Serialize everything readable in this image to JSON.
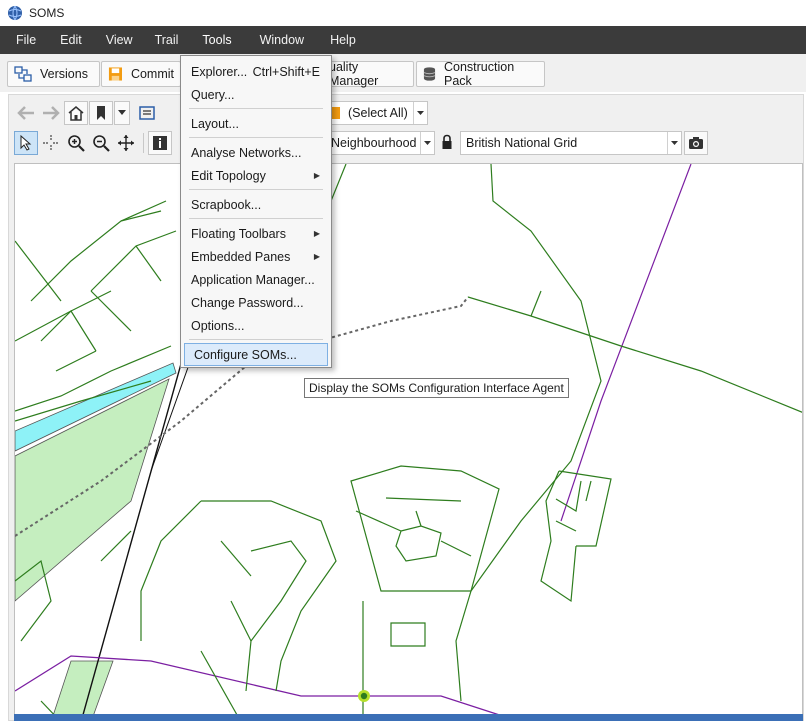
{
  "window": {
    "title": "SOMS",
    "app_icon": "globe-icon"
  },
  "menubar": {
    "items": [
      "File",
      "Edit",
      "View",
      "Trail",
      "Tools",
      "Window",
      "Help"
    ],
    "active": "Tools"
  },
  "toolbar": {
    "versions_label": "Versions",
    "commit_label": "Commit",
    "quality_manager_label": "uality Manager",
    "construction_pack_label": "Construction Pack"
  },
  "map_toolbar": {
    "layer_select_label": "(Select All)",
    "scale_label": "Neighbourhood",
    "projection_label": "British National Grid"
  },
  "tools_menu": {
    "items": [
      {
        "label": "Explorer...",
        "shortcut": "Ctrl+Shift+E",
        "submenu": false
      },
      {
        "label": "Query...",
        "shortcut": "",
        "submenu": false
      },
      {
        "label": "Layout...",
        "shortcut": "",
        "submenu": false
      },
      {
        "label": "Analyse Networks...",
        "shortcut": "",
        "submenu": false
      },
      {
        "label": "Edit Topology",
        "shortcut": "",
        "submenu": true
      },
      {
        "label": "Scrapbook...",
        "shortcut": "",
        "submenu": false
      },
      {
        "label": "Floating Toolbars",
        "shortcut": "",
        "submenu": true
      },
      {
        "label": "Embedded Panes",
        "shortcut": "",
        "submenu": true
      },
      {
        "label": "Application Manager...",
        "shortcut": "",
        "submenu": false
      },
      {
        "label": "Change Password...",
        "shortcut": "",
        "submenu": false
      },
      {
        "label": "Options...",
        "shortcut": "",
        "submenu": false
      },
      {
        "label": "Configure SOMs...",
        "shortcut": "",
        "submenu": false
      }
    ],
    "highlighted": "Configure SOMs..."
  },
  "tooltip": {
    "text": "Display the SOMs Configuration Interface Agent"
  },
  "colors": {
    "menubar_bg": "#3b3b3b",
    "road_line": "#2e7d1e",
    "boundary_line": "#7b1fa2",
    "water_fill": "#8ef2f7",
    "park_fill": "#c5eebf",
    "selected_node": "#b6e02b",
    "status_strip": "#3b6fb6",
    "menu_highlight": "#dcebfb"
  }
}
